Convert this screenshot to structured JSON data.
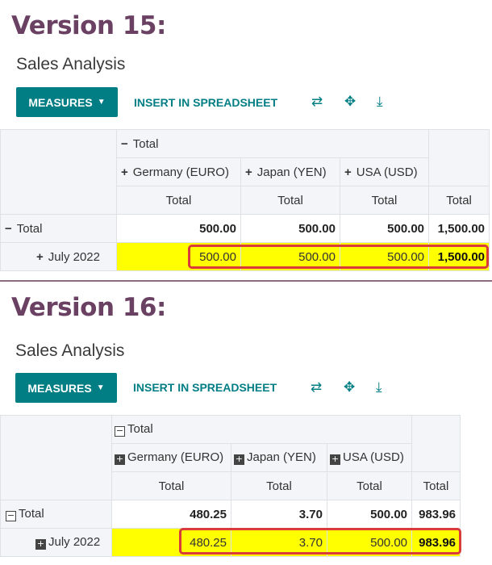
{
  "v15": {
    "title": "Version 15:",
    "breadcrumb": "Sales Analysis",
    "measures_label": "MEASURES",
    "insert_label": "INSERT IN SPREADSHEET",
    "col_group_total": "Total",
    "columns": [
      "Germany (EURO)",
      "Japan (YEN)",
      "USA (USD)"
    ],
    "measure": "Total",
    "row_total": "Total",
    "row_sub": "July 2022",
    "total_values": [
      "500.00",
      "500.00",
      "500.00",
      "1,500.00"
    ],
    "july_values": [
      "500.00",
      "500.00",
      "500.00",
      "1,500.00"
    ]
  },
  "v16": {
    "title": "Version 16:",
    "breadcrumb": "Sales Analysis",
    "measures_label": "MEASURES",
    "insert_label": "INSERT IN SPREADSHEET",
    "col_group_total": "Total",
    "columns": [
      "Germany (EURO)",
      "Japan (YEN)",
      "USA (USD)"
    ],
    "measure": "Total",
    "row_total": "Total",
    "row_sub": "July 2022",
    "total_values": [
      "480.25",
      "3.70",
      "500.00",
      "983.96"
    ],
    "july_values": [
      "480.25",
      "3.70",
      "500.00",
      "983.96"
    ]
  },
  "icons": [
    "flip-axis-icon",
    "expand-all-icon",
    "download-icon"
  ],
  "colors": {
    "accent": "#017e84",
    "title": "#6b4163",
    "highlight": "#ffff00",
    "box": "#d93a3a"
  }
}
